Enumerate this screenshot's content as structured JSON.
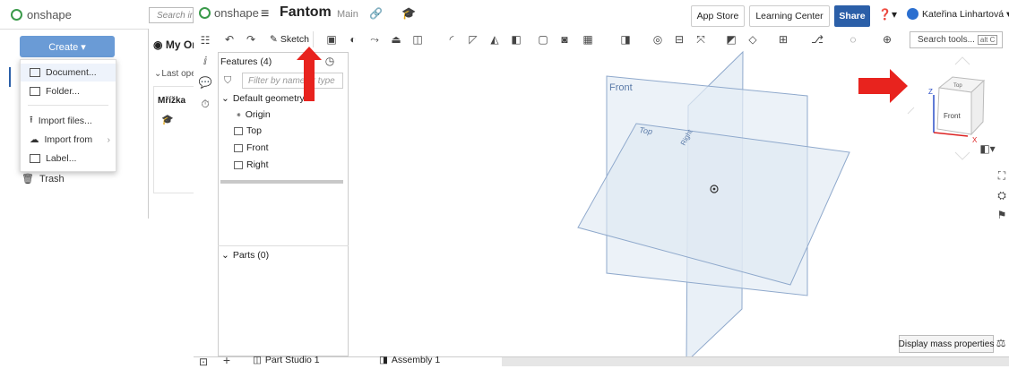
{
  "background_app": {
    "logo": "onshape",
    "search_placeholder": "Search in",
    "create_button": "Create ▾",
    "create_menu": [
      "Document...",
      "Folder...",
      "Import files...",
      "Import from",
      "Label..."
    ],
    "trash": "Trash",
    "my_or": "My Or",
    "last_open": "Last ope",
    "mrizka": "Mřížka"
  },
  "window": {
    "logo": "onshape",
    "menu_icon": "hamburger-icon",
    "doc_title": "Fantom",
    "branch": "Main",
    "app_store": "App Store",
    "learning_center": "Learning Center",
    "share": "Share",
    "user_name": "Kateřina Linhartová ▾"
  },
  "toolbar": {
    "sketch": "Sketch",
    "search_tools": "Search tools...",
    "search_shortcut": "alt C"
  },
  "features": {
    "title": "Features (4)",
    "filter_placeholder": "Filter by name or type",
    "default_geometry": "Default geometry",
    "items": [
      "Origin",
      "Top",
      "Front",
      "Right"
    ],
    "parts": "Parts (0)"
  },
  "viewport": {
    "front_label": "Front",
    "top_label": "Top",
    "right_label": "Right",
    "cube_front": "Front",
    "cube_top": "Top",
    "axis_z": "Z",
    "axis_x": "X",
    "display_mass": "Display mass properties"
  },
  "tabs": {
    "part_studio": "Part Studio 1",
    "assembly": "Assembly 1"
  },
  "colors": {
    "accent": "#2b5fa8",
    "annotation_arrow": "#e8231e",
    "plane_fill": "#dbe6f2",
    "plane_stroke": "#8fa9cc"
  }
}
